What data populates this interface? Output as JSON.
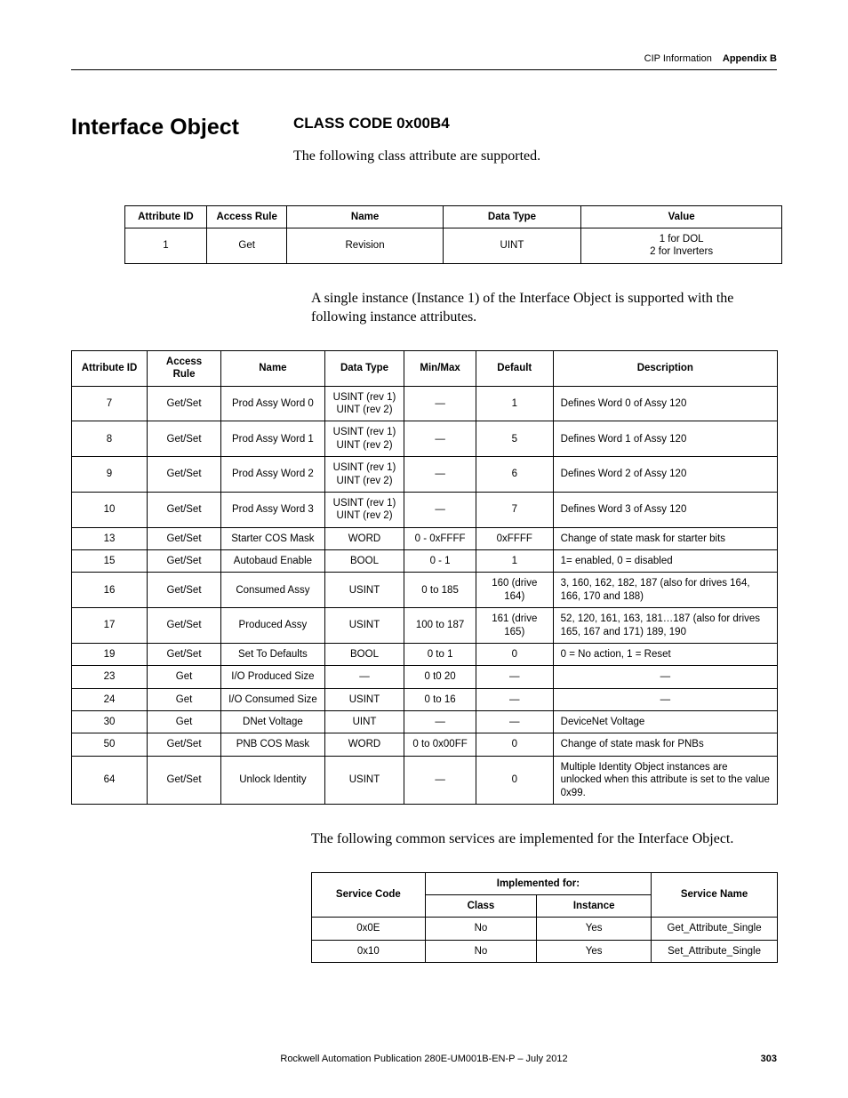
{
  "header": {
    "chapter": "CIP Information",
    "appendix": "Appendix B"
  },
  "title": "Interface Object",
  "classCode": "CLASS CODE 0x00B4",
  "para1": "The following class attribute are supported.",
  "table1": {
    "headers": [
      "Attribute ID",
      "Access Rule",
      "Name",
      "Data Type",
      "Value"
    ],
    "rows": [
      [
        "1",
        "Get",
        "Revision",
        "UINT",
        "1 for DOL\n2 for Inverters"
      ]
    ]
  },
  "para2": "A single instance (Instance 1) of the Interface Object is supported with the following instance attributes.",
  "table2": {
    "headers": [
      "Attribute ID",
      "Access Rule",
      "Name",
      "Data Type",
      "Min/Max",
      "Default",
      "Description"
    ],
    "rows": [
      [
        "7",
        "Get/Set",
        "Prod Assy Word 0",
        "USINT (rev 1)\nUINT (rev 2)",
        "—",
        "1",
        "Defines Word 0 of Assy 120"
      ],
      [
        "8",
        "Get/Set",
        "Prod Assy Word 1",
        "USINT (rev 1)\nUINT (rev 2)",
        "—",
        "5",
        "Defines Word 1 of Assy 120"
      ],
      [
        "9",
        "Get/Set",
        "Prod Assy Word 2",
        "USINT (rev 1)\nUINT (rev 2)",
        "—",
        "6",
        "Defines Word 2 of Assy 120"
      ],
      [
        "10",
        "Get/Set",
        "Prod Assy Word 3",
        "USINT (rev 1)\nUINT (rev 2)",
        "—",
        "7",
        "Defines Word 3 of Assy 120"
      ],
      [
        "13",
        "Get/Set",
        "Starter COS Mask",
        "WORD",
        "0 - 0xFFFF",
        "0xFFFF",
        "Change of state mask for starter bits"
      ],
      [
        "15",
        "Get/Set",
        "Autobaud Enable",
        "BOOL",
        "0 - 1",
        "1",
        "1= enabled, 0 = disabled"
      ],
      [
        "16",
        "Get/Set",
        "Consumed Assy",
        "USINT",
        "0 to 185",
        "160 (drive 164)",
        "3, 160, 162, 182, 187 (also for drives 164, 166, 170 and 188)"
      ],
      [
        "17",
        "Get/Set",
        "Produced Assy",
        "USINT",
        "100 to 187",
        "161 (drive 165)",
        "52, 120, 161, 163, 181…187 (also for drives 165, 167 and 171) 189, 190"
      ],
      [
        "19",
        "Get/Set",
        "Set To Defaults",
        "BOOL",
        "0 to 1",
        "0",
        "0 = No action, 1 = Reset"
      ],
      [
        "23",
        "Get",
        "I/O Produced Size",
        "—",
        "0 t0 20",
        "—",
        "—"
      ],
      [
        "24",
        "Get",
        "I/O Consumed Size",
        "USINT",
        "0 to 16",
        "—",
        "—"
      ],
      [
        "30",
        "Get",
        "DNet Voltage",
        "UINT",
        "—",
        "—",
        "DeviceNet Voltage"
      ],
      [
        "50",
        "Get/Set",
        "PNB COS Mask",
        "WORD",
        "0 to 0x00FF",
        "0",
        "Change of state mask for PNBs"
      ],
      [
        "64",
        "Get/Set",
        "Unlock Identity",
        "USINT",
        "—",
        "0",
        "Multiple Identity Object instances are unlocked when this attribute is set to the value 0x99."
      ]
    ]
  },
  "para3": "The following common services are implemented for the Interface Object.",
  "table3": {
    "spanHeader": "Implemented for:",
    "headers": [
      "Service Code",
      "Class",
      "Instance",
      "Service Name"
    ],
    "rows": [
      [
        "0x0E",
        "No",
        "Yes",
        "Get_Attribute_Single"
      ],
      [
        "0x10",
        "No",
        "Yes",
        "Set_Attribute_Single"
      ]
    ]
  },
  "footer": {
    "pub": "Rockwell Automation Publication 280E-UM001B-EN-P – July 2012",
    "page": "303"
  }
}
